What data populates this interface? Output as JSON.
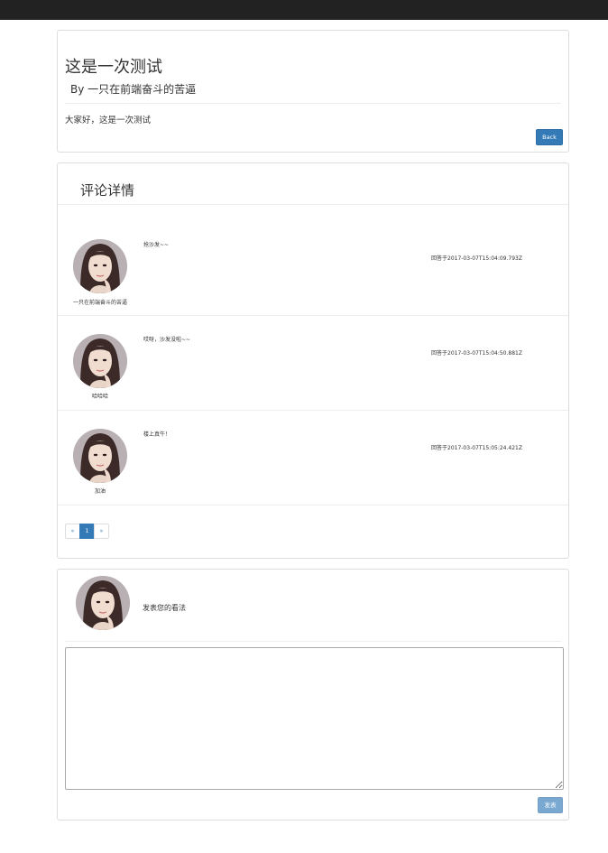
{
  "post": {
    "title": "这是一次测试",
    "author": "By 一只在前端奋斗的苦逼",
    "body": "大家好，这是一次测试",
    "back_label": "Back"
  },
  "comments_section": {
    "title": "评论详情",
    "items": [
      {
        "user": "一只在前端奋斗的苦逼",
        "text": "抢沙发~~",
        "time": "回答于2017-03-07T15:04:09.793Z"
      },
      {
        "user": "哈哈哈",
        "text": "哎呀，沙发没啦~~",
        "time": "回答于2017-03-07T15:04:50.881Z"
      },
      {
        "user": "加油",
        "text": "楼上真牛！",
        "time": "回答于2017-03-07T15:05:24.421Z"
      }
    ],
    "pagination": {
      "prev": "«",
      "current": "1",
      "next": "»"
    }
  },
  "reply": {
    "label": "发表您的看法",
    "textarea_value": "",
    "submit_label": "发表"
  },
  "colors": {
    "navbar": "#222222",
    "primary": "#337ab7",
    "border": "#dddddd"
  }
}
